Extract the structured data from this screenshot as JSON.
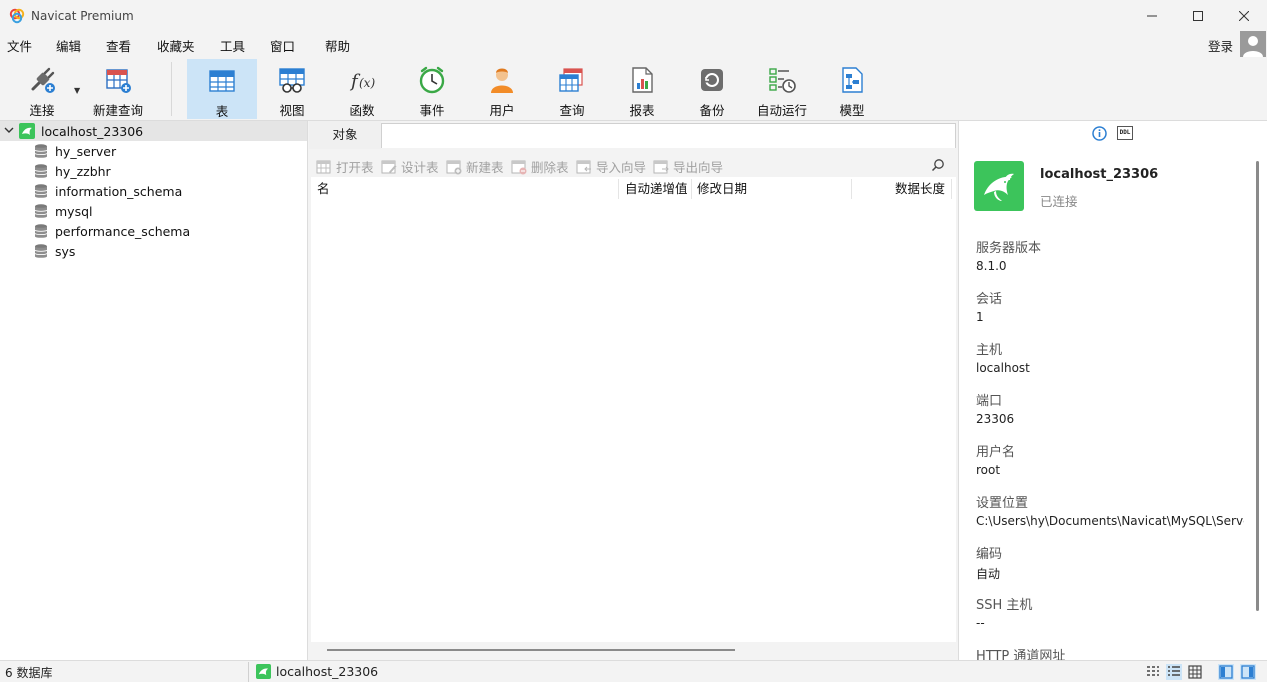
{
  "window": {
    "title": "Navicat Premium"
  },
  "menu": [
    "文件",
    "编辑",
    "查看",
    "收藏夹",
    "工具",
    "窗口",
    "帮助"
  ],
  "login_label": "登录",
  "toolbar": [
    {
      "label": "连接",
      "icon": "connection-plug-icon"
    },
    {
      "label": "新建查询",
      "icon": "new-query-icon"
    },
    {
      "label": "表",
      "icon": "table-icon",
      "active": true
    },
    {
      "label": "视图",
      "icon": "view-glasses-icon"
    },
    {
      "label": "函数",
      "icon": "function-icon"
    },
    {
      "label": "事件",
      "icon": "event-clock-icon"
    },
    {
      "label": "用户",
      "icon": "user-icon"
    },
    {
      "label": "查询",
      "icon": "query-icon"
    },
    {
      "label": "报表",
      "icon": "report-icon"
    },
    {
      "label": "备份",
      "icon": "backup-icon"
    },
    {
      "label": "自动运行",
      "icon": "automation-icon"
    },
    {
      "label": "模型",
      "icon": "model-icon"
    }
  ],
  "navigation": {
    "connection": "localhost_23306",
    "databases": [
      "hy_server",
      "hy_zzbhr",
      "information_schema",
      "mysql",
      "performance_schema",
      "sys"
    ]
  },
  "objects": {
    "tab": "对象",
    "actions": [
      "打开表",
      "设计表",
      "新建表",
      "删除表",
      "导入向导",
      "导出向导"
    ],
    "columns": [
      "名",
      "自动递增值",
      "修改日期",
      "数据长度"
    ]
  },
  "info": {
    "name": "localhost_23306",
    "status": "已连接",
    "properties": [
      {
        "label": "服务器版本",
        "value": "8.1.0"
      },
      {
        "label": "会话",
        "value": "1"
      },
      {
        "label": "主机",
        "value": "localhost"
      },
      {
        "label": "端口",
        "value": "23306"
      },
      {
        "label": "用户名",
        "value": "root"
      },
      {
        "label": "设置位置",
        "value": "C:\\Users\\hy\\Documents\\Navicat\\MySQL\\Servers"
      },
      {
        "label": "编码",
        "value": "自动"
      },
      {
        "label": "SSH 主机",
        "value": "--"
      },
      {
        "label": "HTTP 通道网址",
        "value": ""
      }
    ],
    "ddl_label": "DDL"
  },
  "status": {
    "count": "6 数据库",
    "connection": "localhost_23306"
  },
  "colors": {
    "accent": "#cce4f7",
    "mysql_green": "#3cc45b"
  }
}
